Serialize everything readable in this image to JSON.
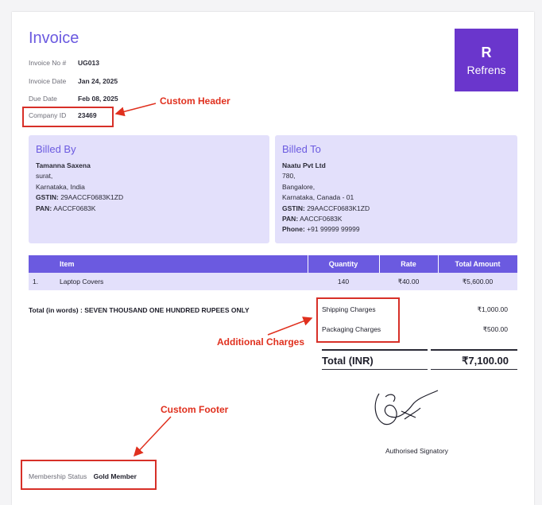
{
  "invoice_title": "Invoice",
  "meta": {
    "invoice_no_label": "Invoice No #",
    "invoice_no": "UG013",
    "invoice_date_label": "Invoice Date",
    "invoice_date": "Jan 24, 2025",
    "due_date_label": "Due Date",
    "due_date": "Feb 08, 2025",
    "company_id_label": "Company ID",
    "company_id": "23469"
  },
  "logo": {
    "text": "Refrens",
    "mark": "R"
  },
  "annotations": {
    "custom_header": "Custom Header",
    "additional_charges": "Additional Charges",
    "custom_footer": "Custom Footer",
    "color": "#e0301e"
  },
  "billed_by": {
    "title": "Billed By",
    "name": "Tamanna Saxena",
    "line1": "surat,",
    "line2": "Karnataka, India",
    "gstin_label": "GSTIN:",
    "gstin": "29AACCF0683K1ZD",
    "pan_label": "PAN:",
    "pan": "AACCF0683K"
  },
  "billed_to": {
    "title": "Billed To",
    "name": "Naatu Pvt Ltd",
    "line1": "780,",
    "line2": "Bangalore,",
    "line3": "Karnataka, Canada - 01",
    "gstin_label": "GSTIN:",
    "gstin": "29AACCF0683K1ZD",
    "pan_label": "PAN:",
    "pan": "AACCF0683K",
    "phone_label": "Phone:",
    "phone": "+91 99999 99999"
  },
  "table": {
    "headers": {
      "item": "Item",
      "quantity": "Quantity",
      "rate": "Rate",
      "amount": "Total Amount"
    },
    "rows": [
      {
        "index": "1.",
        "item": "Laptop Covers",
        "quantity": "140",
        "rate": "₹40.00",
        "amount": "₹5,600.00"
      }
    ]
  },
  "total_in_words": "Total (in words) : SEVEN THOUSAND ONE HUNDRED RUPEES ONLY",
  "charges": [
    {
      "label": "Shipping Charges",
      "amount": "₹1,000.00"
    },
    {
      "label": "Packaging Charges",
      "amount": "₹500.00"
    }
  ],
  "total": {
    "label": "Total (INR)",
    "amount": "₹7,100.00"
  },
  "signature_label": "Authorised Signatory",
  "footer": {
    "label": "Membership Status",
    "value": "Gold Member"
  },
  "colors": {
    "accent": "#6b5ae0",
    "panel": "#e3e0fb",
    "logo_bg": "#6a36cc"
  }
}
